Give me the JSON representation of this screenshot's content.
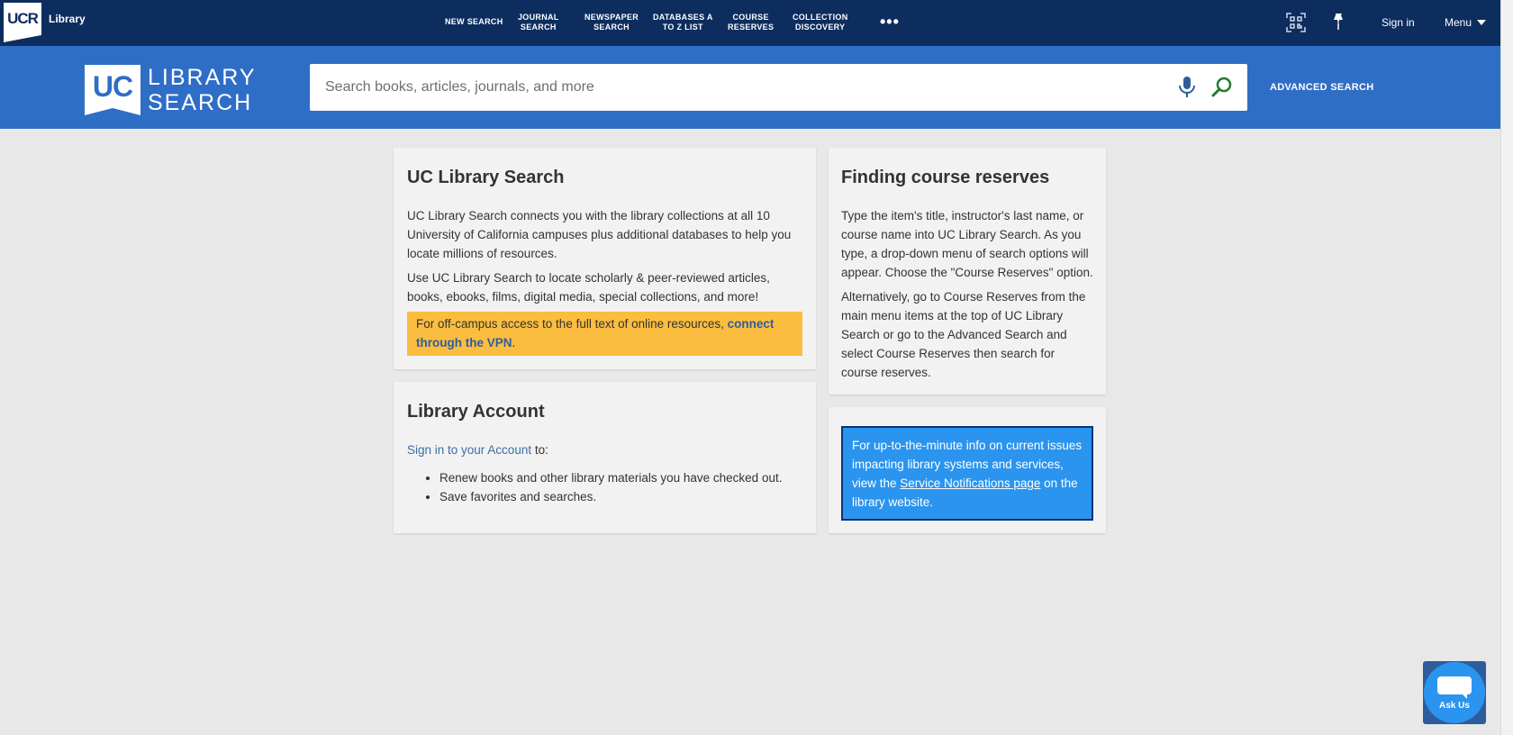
{
  "header": {
    "logo_text": "UCR",
    "library_label": "Library",
    "nav": [
      "NEW SEARCH",
      "JOURNAL\nSEARCH",
      "NEWSPAPER\nSEARCH",
      "DATABASES A\nTO Z LIST",
      "COURSE\nRESERVES",
      "COLLECTION\nDISCOVERY"
    ],
    "more": "•••",
    "signin": "Sign in",
    "menu": "Menu"
  },
  "searchband": {
    "logo_short": "UC",
    "logo_line1": "LIBRARY",
    "logo_line2": "SEARCH",
    "placeholder": "Search books, articles, journals, and more",
    "advanced": "ADVANCED SEARCH"
  },
  "card_search": {
    "title": "UC Library Search",
    "p1": "UC Library Search connects you with the library collections at all 10 University of California campuses plus additional databases to help you locate millions of resources.",
    "p2": "Use UC Library Search to locate scholarly & peer-reviewed articles, books, ebooks, films, digital media, special collections, and more!",
    "alert_text": "For off-campus access to the full text of online resources, ",
    "alert_link": "connect through the VPN",
    "alert_end": "."
  },
  "card_account": {
    "title": "Library Account",
    "signin_link": "Sign in to your Account",
    "signin_rest": " to:",
    "bullets": [
      "Renew books and other library materials you have checked out.",
      "Save favorites and searches."
    ]
  },
  "card_reserves": {
    "title": "Finding course reserves",
    "p1": "Type the item's title, instructor's last name, or course name into UC Library Search. As you type, a drop-down menu of search options will appear. Choose the \"Course Reserves\" option.",
    "p2": "Alternatively, go to Course Reserves from the main menu items at the top of UC Library Search or go to the Advanced Search and select Course Reserves then search for course reserves."
  },
  "card_notice": {
    "text1": "For up-to-the-minute info on current issues impacting library systems and services, view the ",
    "link": "Service Notifications page",
    "text2": " on the library website."
  },
  "askus": {
    "label": "Ask Us"
  },
  "colors": {
    "topbar": "#0c2d5e",
    "searchband": "#2f6ec6",
    "alert_yellow": "#fbbd3f",
    "notice_blue": "#2b94ee"
  }
}
